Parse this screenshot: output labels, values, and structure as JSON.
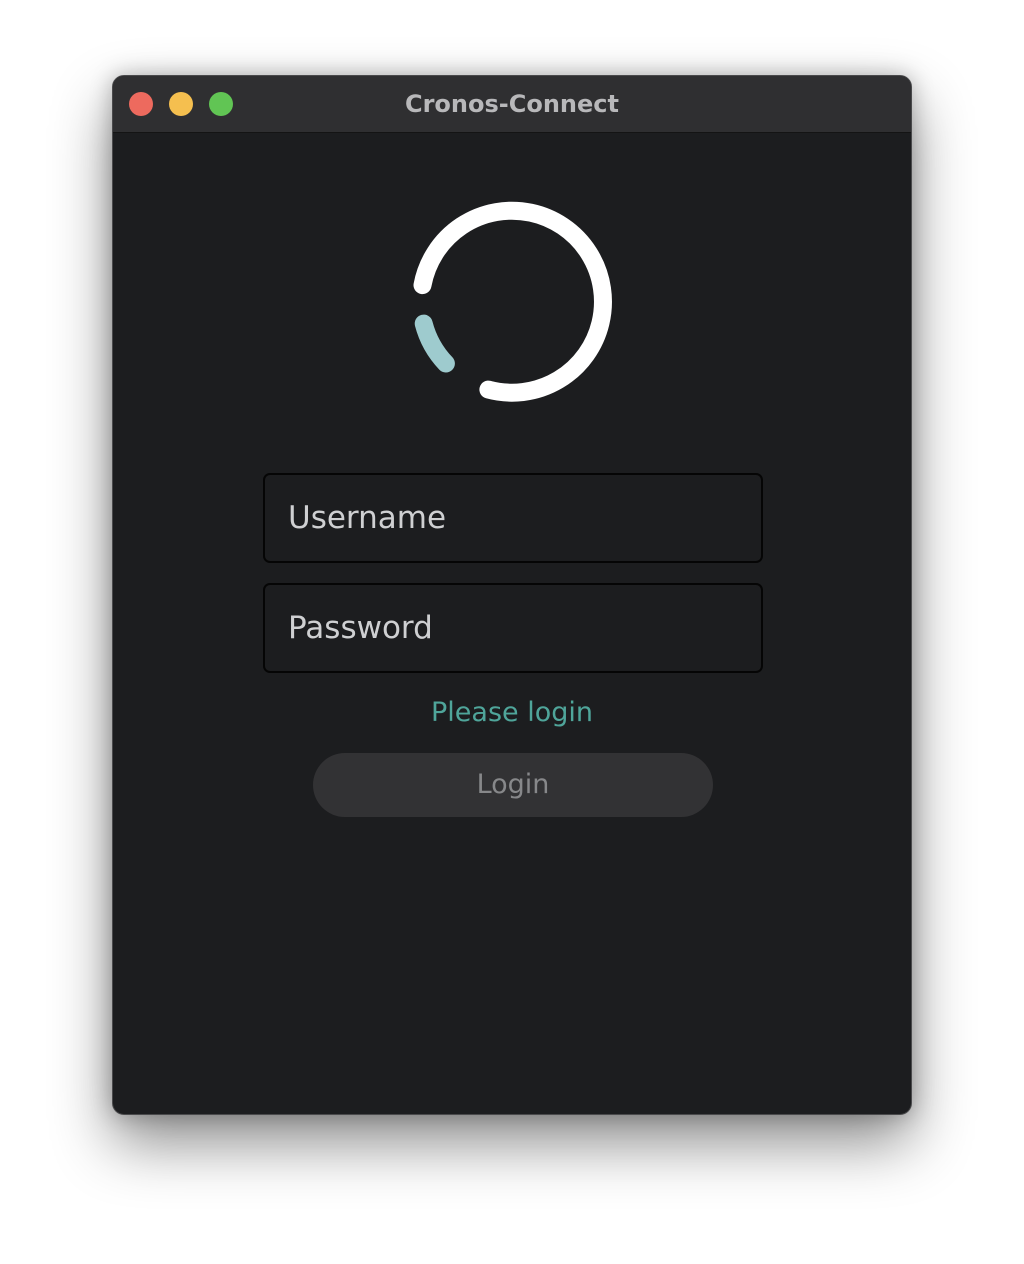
{
  "window": {
    "title": "Cronos-Connect"
  },
  "traffic_lights": {
    "close_color": "#ed6a5e",
    "minimize_color": "#f5bf4f",
    "zoom_color": "#61c554"
  },
  "spinner": {
    "icon": "loading-spinner-icon",
    "arc_color": "#ffffff",
    "accent_color": "#9ecbce"
  },
  "form": {
    "username_placeholder": "Username",
    "password_placeholder": "Password",
    "status_text": "Please login",
    "status_color": "#4fa59a",
    "login_label": "Login"
  }
}
